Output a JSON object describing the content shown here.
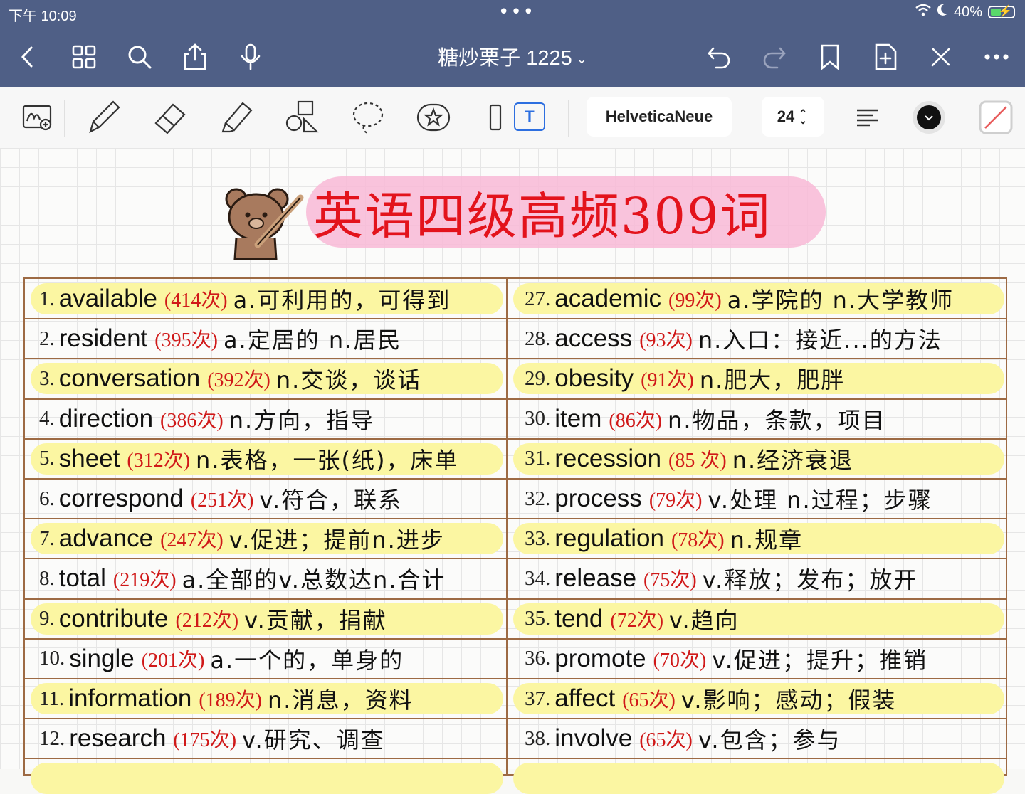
{
  "status": {
    "time": "下午 10:09",
    "battery": "40%",
    "dots": "•••"
  },
  "nav": {
    "title": "糖炒栗子 1225",
    "title_chevron": "⌄"
  },
  "toolbar": {
    "font": "HelveticaNeue",
    "size": "24",
    "text_tool": "T",
    "size_chevron": "⌃⌄"
  },
  "page": {
    "title": "英语四级高频309词"
  },
  "colors": {
    "header": "#4f5f86",
    "freq": "#d01919",
    "title": "#e3131c",
    "highlight": "#fbf6a2",
    "border": "#9d6a44"
  },
  "left": [
    {
      "num": "1.",
      "word": "available",
      "freq": "(414次)",
      "def": "a.可利用的，可得到"
    },
    {
      "num": "2.",
      "word": "resident",
      "freq": "(395次)",
      "def": "a.定居的 n.居民"
    },
    {
      "num": "3.",
      "word": "conversation",
      "freq": "(392次)",
      "def": "n.交谈，谈话"
    },
    {
      "num": "4.",
      "word": "direction",
      "freq": "(386次)",
      "def": "n.方向，指导"
    },
    {
      "num": "5.",
      "word": "sheet",
      "freq": "(312次)",
      "def": "n.表格，一张(纸)，床单"
    },
    {
      "num": "6.",
      "word": "correspond",
      "freq": "(251次)",
      "def": "v.符合，联系"
    },
    {
      "num": "7.",
      "word": "advance",
      "freq": "(247次)",
      "def": "v.促进；提前n.进步"
    },
    {
      "num": "8.",
      "word": "total",
      "freq": "(219次)",
      "def": "a.全部的v.总数达n.合计"
    },
    {
      "num": "9.",
      "word": "contribute",
      "freq": "(212次)",
      "def": "v.贡献，捐献"
    },
    {
      "num": "10.",
      "word": "single",
      "freq": "(201次)",
      "def": "a.一个的，单身的"
    },
    {
      "num": "11.",
      "word": "information",
      "freq": "(189次)",
      "def": "n.消息，资料"
    },
    {
      "num": "12.",
      "word": "research",
      "freq": "(175次)",
      "def": "v.研究、调查"
    }
  ],
  "right": [
    {
      "num": "27.",
      "word": "academic",
      "freq": "(99次)",
      "def": "a.学院的 n.大学教师"
    },
    {
      "num": "28.",
      "word": "access",
      "freq": "(93次)",
      "def": "n.入口：接近...的方法"
    },
    {
      "num": "29.",
      "word": "obesity",
      "freq": "(91次)",
      "def": "n.肥大，肥胖"
    },
    {
      "num": "30.",
      "word": "item",
      "freq": "(86次)",
      "def": "n.物品，条款，项目"
    },
    {
      "num": "31.",
      "word": "recession",
      "freq": "(85 次)",
      "def": "n.经济衰退"
    },
    {
      "num": "32.",
      "word": "process",
      "freq": "(79次)",
      "def": "v.处理 n.过程；步骤"
    },
    {
      "num": "33.",
      "word": "regulation",
      "freq": "(78次)",
      "def": "n.规章"
    },
    {
      "num": "34.",
      "word": "release",
      "freq": "(75次)",
      "def": "v.释放；发布；放开"
    },
    {
      "num": "35.",
      "word": "tend",
      "freq": "(72次)",
      "def": "v.趋向"
    },
    {
      "num": "36.",
      "word": "promote",
      "freq": "(70次)",
      "def": "v.促进；提升；推销"
    },
    {
      "num": "37.",
      "word": "affect",
      "freq": "(65次)",
      "def": "v.影响；感动；假装"
    },
    {
      "num": "38.",
      "word": "involve",
      "freq": "(65次)",
      "def": "v.包含；参与"
    }
  ]
}
